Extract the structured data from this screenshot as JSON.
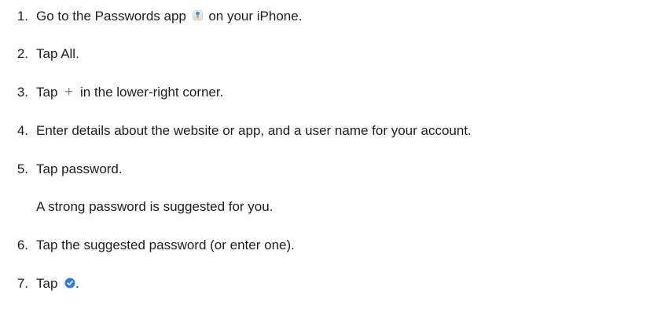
{
  "steps": [
    {
      "num": "1.",
      "before": "Go to the Passwords app",
      "after": "on your iPhone.",
      "icon": "passwords-app-icon"
    },
    {
      "num": "2.",
      "text": "Tap All."
    },
    {
      "num": "3.",
      "before": "Tap",
      "icon_text": "+",
      "after": "in the lower-right corner.",
      "icon": "plus-icon"
    },
    {
      "num": "4.",
      "text": "Enter details about the website or app, and a user name for your account."
    },
    {
      "num": "5.",
      "text": "Tap password."
    },
    {
      "num": "6.",
      "text": "Tap the suggested password (or enter one)."
    },
    {
      "num": "7.",
      "before": "Tap",
      "after": ".",
      "icon": "checkmark-circle-icon"
    }
  ],
  "note_after_step5": "A strong password is suggested for you.",
  "colors": {
    "text": "#1d1d1f",
    "checkmark_circle": "#2f7ce5",
    "plus": "#8a8a8e"
  }
}
